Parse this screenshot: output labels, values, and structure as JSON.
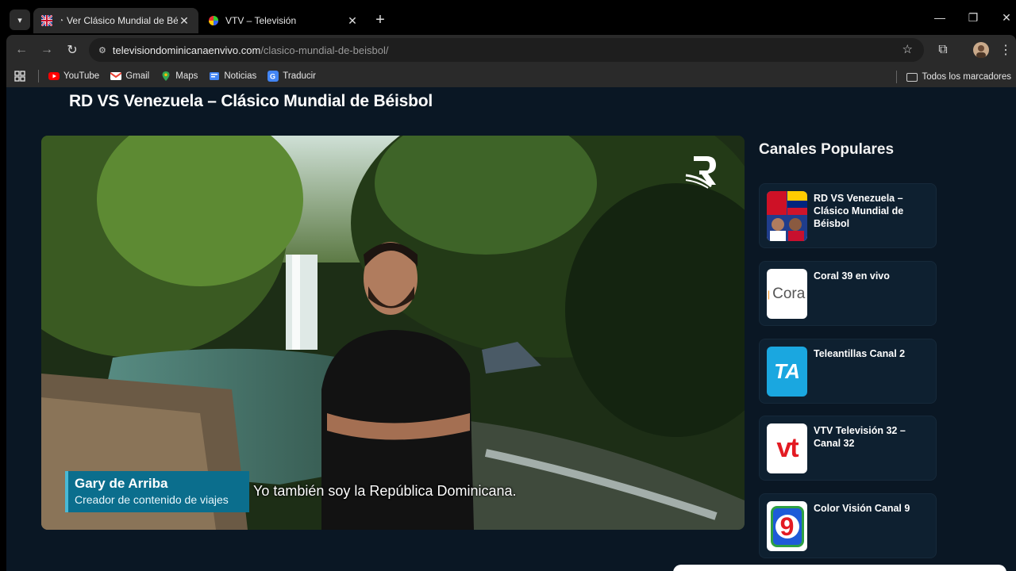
{
  "tabs": [
    {
      "title": "Ver Clásico Mundial de Béisb",
      "active": true
    },
    {
      "title": "VTV – Televisión",
      "active": false
    }
  ],
  "address": {
    "host": "televisiondominicanaenvivo.com",
    "path": "/clasico-mundial-de-beisbol/"
  },
  "bookmarks": [
    {
      "label": "YouTube",
      "icon": "youtube-icon",
      "color": "#ff0000"
    },
    {
      "label": "Gmail",
      "icon": "gmail-icon",
      "color": "#ea4335"
    },
    {
      "label": "Maps",
      "icon": "maps-icon",
      "color": "#34a853"
    },
    {
      "label": "Noticias",
      "icon": "news-icon",
      "color": "#4285f4"
    },
    {
      "label": "Traducir",
      "icon": "translate-icon",
      "color": "#4285f4"
    }
  ],
  "all_bookmarks_label": "Todos los marcadores",
  "page": {
    "title": "RD VS Venezuela – Clásico Mundial de Béisbol"
  },
  "video": {
    "lower_third_name": "Gary de Arriba",
    "lower_third_role": "Creador de contenido de viajes",
    "subtitle": "Yo también soy la República Dominicana."
  },
  "sidebar": {
    "title": "Canales Populares",
    "channels": [
      {
        "name": "RD VS Venezuela – Clásico Mundial de Béisbol"
      },
      {
        "name": "Coral 39 en vivo",
        "thumb_text": "Cora"
      },
      {
        "name": "Teleantillas Canal 2",
        "thumb_text": "TA"
      },
      {
        "name": "VTV Televisión 32 – Canal 32",
        "thumb_text": "vt"
      },
      {
        "name": "Color Visión Canal 9",
        "thumb_text": "9"
      }
    ]
  },
  "colors": {
    "page_bg": "#0a1724",
    "card_bg": "#0e2030",
    "lower_third": "#0b6e8d"
  }
}
